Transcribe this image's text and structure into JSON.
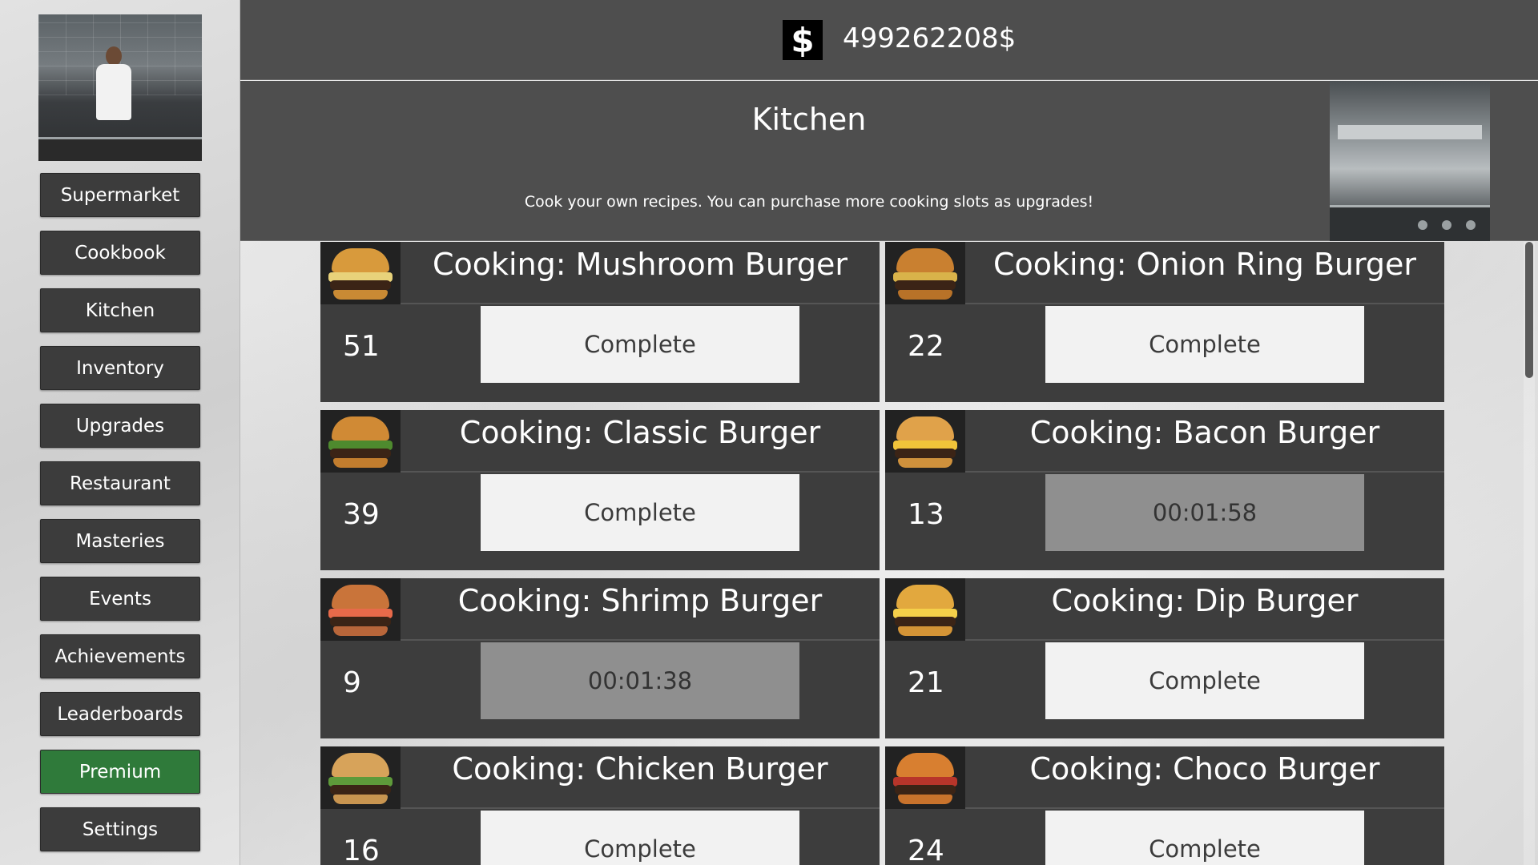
{
  "currency": {
    "icon": "dollar-icon",
    "symbol": "$",
    "amount": "499262208$"
  },
  "sidebar": {
    "items": [
      {
        "label": "Supermarket",
        "key": "supermarket"
      },
      {
        "label": "Cookbook",
        "key": "cookbook"
      },
      {
        "label": "Kitchen",
        "key": "kitchen"
      },
      {
        "label": "Inventory",
        "key": "inventory"
      },
      {
        "label": "Upgrades",
        "key": "upgrades"
      },
      {
        "label": "Restaurant",
        "key": "restaurant"
      },
      {
        "label": "Masteries",
        "key": "masteries"
      },
      {
        "label": "Events",
        "key": "events"
      },
      {
        "label": "Achievements",
        "key": "achievements"
      },
      {
        "label": "Leaderboards",
        "key": "leaderboards"
      },
      {
        "label": "Premium",
        "key": "premium"
      },
      {
        "label": "Settings",
        "key": "settings"
      }
    ]
  },
  "header": {
    "title": "Kitchen",
    "description": "Cook your own recipes. You can purchase more cooking slots as upgrades!"
  },
  "slots": [
    {
      "name": "Cooking: Mushroom Burger",
      "count": "51",
      "action": "Complete",
      "state": "complete"
    },
    {
      "name": "Cooking: Onion Ring Burger",
      "count": "22",
      "action": "Complete",
      "state": "complete"
    },
    {
      "name": "Cooking: Classic Burger",
      "count": "39",
      "action": "Complete",
      "state": "complete"
    },
    {
      "name": "Cooking: Bacon Burger",
      "count": "13",
      "action": "00:01:58",
      "state": "timer"
    },
    {
      "name": "Cooking: Shrimp Burger",
      "count": "9",
      "action": "00:01:38",
      "state": "timer"
    },
    {
      "name": "Cooking: Dip Burger",
      "count": "21",
      "action": "Complete",
      "state": "complete"
    },
    {
      "name": "Cooking: Chicken Burger",
      "count": "16",
      "action": "Complete",
      "state": "complete"
    },
    {
      "name": "Cooking: Choco Burger",
      "count": "24",
      "action": "Complete",
      "state": "complete"
    }
  ],
  "colors": {
    "panel": "#4e4e4e",
    "slot": "#3d3d3d",
    "button": "#f2f2f2",
    "timer_button": "#8f8f8f",
    "premium": "#2f7a3a"
  }
}
